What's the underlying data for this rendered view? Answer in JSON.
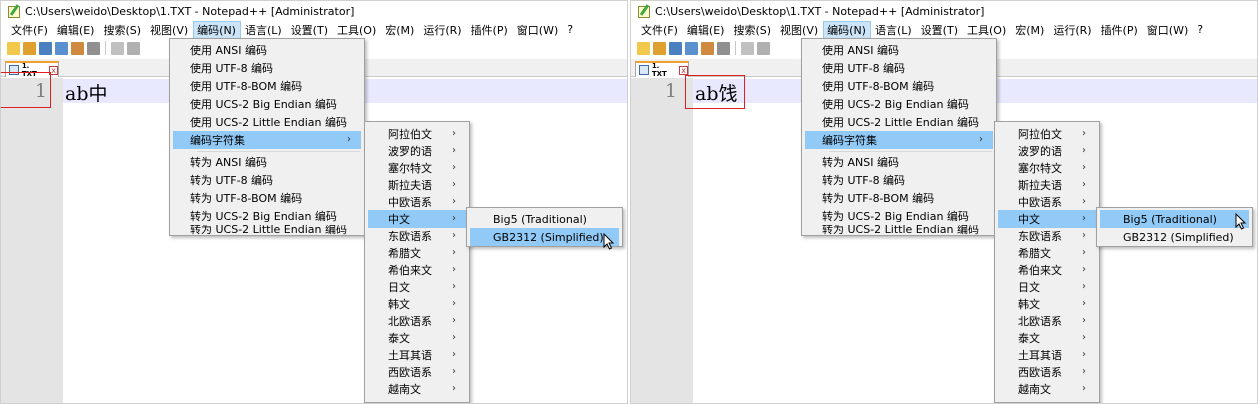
{
  "window": {
    "title": "C:\\Users\\weido\\Desktop\\1.TXT - Notepad++ [Administrator]"
  },
  "menubar": [
    "文件(F)",
    "编辑(E)",
    "搜索(S)",
    "视图(V)",
    "编码(N)",
    "语言(L)",
    "设置(T)",
    "工具(O)",
    "宏(M)",
    "运行(R)",
    "插件(P)",
    "窗口(W)",
    "?"
  ],
  "tab": {
    "label": "1. TXT",
    "close": "x"
  },
  "editor": {
    "line_number": "1",
    "left_text": "ab中",
    "right_text": "ab饯"
  },
  "encoding_menu": {
    "items": [
      "使用 ANSI 编码",
      "使用 UTF-8 编码",
      "使用 UTF-8-BOM 编码",
      "使用 UCS-2 Big Endian 编码",
      "使用 UCS-2 Little Endian 编码",
      "编码字符集",
      "转为 ANSI 编码",
      "转为 UTF-8 编码",
      "转为 UTF-8-BOM 编码",
      "转为 UCS-2 Big Endian 编码",
      "转为 UCS-2 Little Endian 编码"
    ],
    "highlighted_index": 5
  },
  "charset_submenu": {
    "items": [
      "阿拉伯文",
      "波罗的语",
      "塞尔特文",
      "斯拉夫语",
      "中欧语系",
      "中文",
      "东欧语系",
      "希腊文",
      "希伯来文",
      "日文",
      "韩文",
      "北欧语系",
      "泰文",
      "土耳其语",
      "西欧语系",
      "越南文"
    ],
    "highlighted_index": 5
  },
  "chinese_submenu": {
    "items": [
      "Big5 (Traditional)",
      "GB2312 (Simplified)"
    ],
    "left_highlighted_index": 1,
    "right_highlighted_index": 0
  },
  "arrow_glyph": "›",
  "colors": {
    "menu_highlight": "#91c9f7",
    "menu_background": "#f0f0f0",
    "annotation_box": "#e02020",
    "current_line": "#e8e8ff"
  }
}
